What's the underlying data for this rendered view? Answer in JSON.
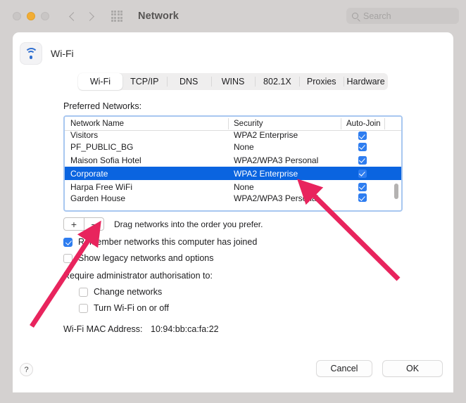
{
  "window": {
    "title": "Network",
    "traffic_lights": [
      "close",
      "minimize",
      "maximize"
    ],
    "back_label": "Back",
    "forward_label": "Forward",
    "grid_label": "All preferences"
  },
  "search": {
    "placeholder": "Search",
    "value": ""
  },
  "sheet": {
    "service_name": "Wi-Fi",
    "tabs": [
      {
        "label": "Wi-Fi",
        "selected": true
      },
      {
        "label": "TCP/IP",
        "selected": false
      },
      {
        "label": "DNS",
        "selected": false
      },
      {
        "label": "WINS",
        "selected": false
      },
      {
        "label": "802.1X",
        "selected": false
      },
      {
        "label": "Proxies",
        "selected": false
      },
      {
        "label": "Hardware",
        "selected": false
      }
    ],
    "preferred_networks_label": "Preferred Networks:",
    "table": {
      "columns": [
        "Network Name",
        "Security",
        "Auto-Join"
      ],
      "rows": [
        {
          "name": "Visitors",
          "security": "WPA2 Enterprise",
          "auto_join": true,
          "selected": false,
          "clipped": "top"
        },
        {
          "name": "PF_PUBLIC_BG",
          "security": "None",
          "auto_join": true,
          "selected": false,
          "clipped": ""
        },
        {
          "name": "Maison Sofia Hotel",
          "security": "WPA2/WPA3 Personal",
          "auto_join": true,
          "selected": false,
          "clipped": ""
        },
        {
          "name": "Corporate",
          "security": "WPA2 Enterprise",
          "auto_join": true,
          "selected": true,
          "clipped": ""
        },
        {
          "name": "Harpa Free WiFi",
          "security": "None",
          "auto_join": true,
          "selected": false,
          "clipped": ""
        },
        {
          "name": "Garden House",
          "security": "WPA2/WPA3 Personal",
          "auto_join": true,
          "selected": false,
          "clipped": "bottom"
        }
      ]
    },
    "add_button_label": "+",
    "remove_button_label": "−",
    "drag_hint": "Drag networks into the order you prefer.",
    "options": [
      {
        "label": "Remember networks this computer has joined",
        "checked": true
      },
      {
        "label": "Show legacy networks and options",
        "checked": false
      }
    ],
    "require_admin_label": "Require administrator authorisation to:",
    "admin_options": [
      {
        "label": "Change networks",
        "checked": false
      },
      {
        "label": "Turn Wi-Fi on or off",
        "checked": false
      }
    ],
    "mac_label": "Wi-Fi MAC Address:",
    "mac_value": "10:94:bb:ca:fa:22"
  },
  "footer": {
    "help_label": "?",
    "cancel_label": "Cancel",
    "ok_label": "OK"
  },
  "annotations": {
    "arrow_color": "#e8245d",
    "arrow_1_target": "Corporate network row",
    "arrow_2_target": "Remove network button"
  },
  "colors": {
    "accent": "#0a64e0",
    "checkbox": "#2e7df0",
    "window_bg": "#d4d1d0",
    "sheet_bg": "#ffffff",
    "focus_ring": "#a8c7f0",
    "annotation_red": "#e8245d"
  }
}
